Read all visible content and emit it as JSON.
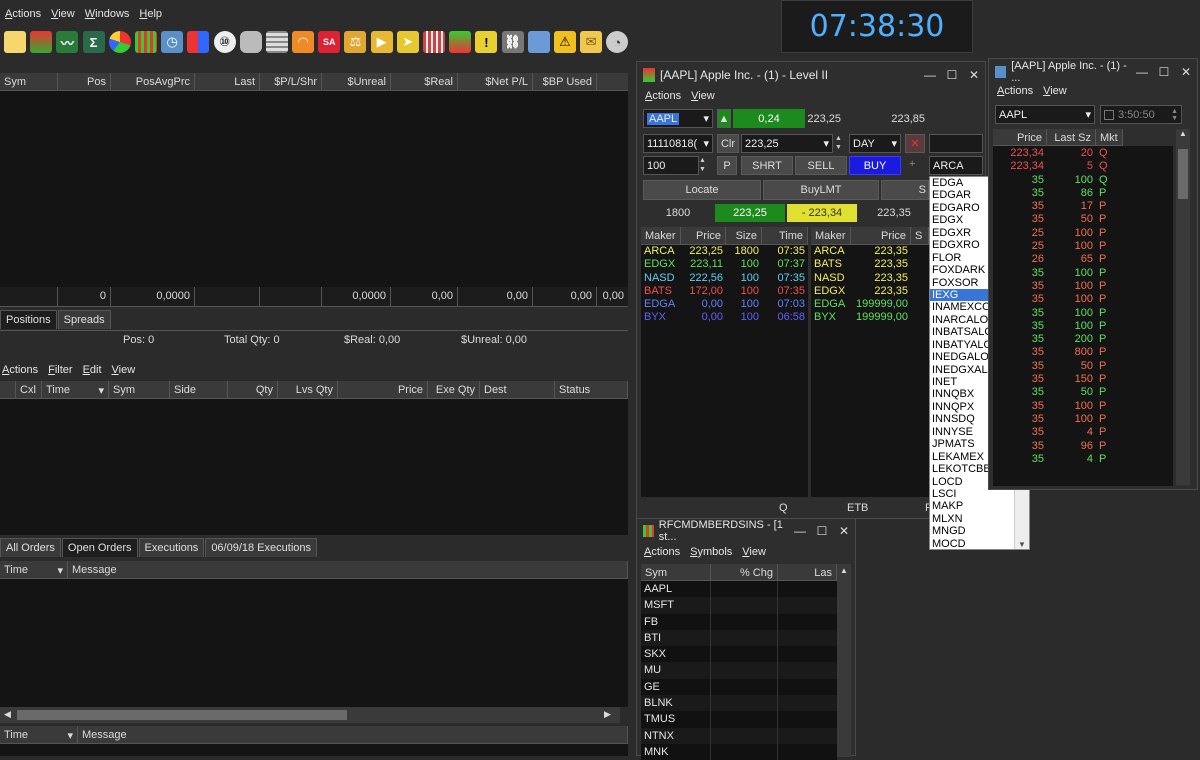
{
  "main": {
    "menu": [
      "Actions",
      "View",
      "Windows",
      "Help"
    ],
    "toolbar_icons": [
      "new-document-icon",
      "book-icon",
      "chart-icon",
      "sigma-icon",
      "pie-icon",
      "bars-icon",
      "calendar-icon",
      "dart-icon",
      "ball-icon",
      "database-icon",
      "grid-icon",
      "rss-icon",
      "sa-icon",
      "scale-icon",
      "speaker-icon",
      "arrow-icon",
      "grid2-icon",
      "doc-icon",
      "warning-icon",
      "link-icon",
      "notebook-icon",
      "alert-icon",
      "mail-icon",
      "gauge-icon"
    ],
    "clock": "07:38:30"
  },
  "positions": {
    "columns": [
      "Sym",
      "Pos",
      "PosAvgPrc",
      "Last",
      "$P/L/Shr",
      "$Unreal",
      "$Real",
      "$Net P/L",
      "$BP Used"
    ],
    "totals": [
      "",
      "0",
      "0,0000",
      "",
      "",
      "0,0000",
      "0,00",
      "0,00",
      "0,00",
      "0,00"
    ],
    "tabs": [
      "Positions",
      "Spreads"
    ],
    "summary": {
      "pos": "Pos: 0",
      "total_qty": "Total Qty: 0",
      "real": "$Real: 0,00",
      "unreal": "$Unreal: 0,00"
    }
  },
  "orders": {
    "menu": [
      "Actions",
      "Filter",
      "Edit",
      "View"
    ],
    "columns": [
      "Cxl",
      "Time",
      "Sym",
      "Side",
      "Qty",
      "Lvs Qty",
      "Price",
      "Exe Qty",
      "Dest",
      "Status"
    ],
    "tabs": [
      "All Orders",
      "Open Orders",
      "Executions",
      "06/09/18 Executions"
    ],
    "msg_columns": [
      "Time",
      "Message"
    ],
    "bottom_columns": [
      "Time",
      "Message"
    ]
  },
  "level2": {
    "title": "[AAPL] Apple Inc. - (1) - Level II",
    "menu": [
      "Actions",
      "View"
    ],
    "symbol": "AAPL",
    "change": "0,24",
    "bid": "223,25",
    "ask": "223,85",
    "account": "11110818(",
    "clr": "Clr",
    "price": "223,25",
    "tif": "DAY",
    "qty": "100",
    "p_label": "P",
    "shrt": "SHRT",
    "sell": "SELL",
    "buy": "BUY",
    "route": "ARCA",
    "locate": "Locate",
    "buylmt": "BuyLMT",
    "s_cut": "S",
    "summary": {
      "size": "1800",
      "bid": "223,25",
      "diff": "- 223,34",
      "ask": "223,35"
    },
    "book_columns": [
      "Maker",
      "Price",
      "Size",
      "Time"
    ],
    "bids": [
      {
        "maker": "ARCA",
        "price": "223,25",
        "size": "1800",
        "time": "07:35",
        "color": "#f0f060"
      },
      {
        "maker": "EDGX",
        "price": "223,11",
        "size": "100",
        "time": "07:37",
        "color": "#60e060"
      },
      {
        "maker": "NASD",
        "price": "222,56",
        "size": "100",
        "time": "07:35",
        "color": "#60d0f0"
      },
      {
        "maker": "BATS",
        "price": "172,00",
        "size": "100",
        "time": "07:35",
        "color": "#f05050"
      },
      {
        "maker": "EDGA",
        "price": "0,00",
        "size": "100",
        "time": "07:03",
        "color": "#6080ff"
      },
      {
        "maker": "BYX",
        "price": "0,00",
        "size": "100",
        "time": "06:58",
        "color": "#6060ff"
      }
    ],
    "ask_columns": [
      "Maker",
      "Price",
      "S"
    ],
    "asks": [
      {
        "maker": "ARCA",
        "price": "223,35",
        "color": "#f0f060"
      },
      {
        "maker": "BATS",
        "price": "223,35",
        "color": "#f0f060"
      },
      {
        "maker": "NASD",
        "price": "223,35",
        "color": "#f0f060"
      },
      {
        "maker": "EDGX",
        "price": "223,35",
        "color": "#f0f060"
      },
      {
        "maker": "EDGA",
        "price": "199999,00",
        "color": "#60e060"
      },
      {
        "maker": "BYX",
        "price": "199999,00",
        "color": "#60e060"
      }
    ],
    "footer": [
      "Q",
      "ETB",
      "F"
    ],
    "dropdown": [
      "EDGA",
      "EDGAR",
      "EDGARO",
      "EDGX",
      "EDGXR",
      "EDGXRO",
      "FLOR",
      "FOXDARK",
      "FOXSOR",
      "IEXG",
      "INAMEXCO",
      "INARCALO",
      "INBATSALO",
      "INBATYALO",
      "INEDGALO",
      "INEDGXALO",
      "INET",
      "INNQBX",
      "INNQPX",
      "INNSDQ",
      "INNYSE",
      "JPMATS",
      "LEKAMEX",
      "LEKOTCBB",
      "LOCD",
      "LSCI",
      "MAKP",
      "MLXN",
      "MNGD",
      "MOCD"
    ],
    "dropdown_selected": 9
  },
  "timesales": {
    "title": "[AAPL] Apple Inc. - (1) - ...",
    "menu": [
      "Actions",
      "View"
    ],
    "symbol": "AAPL",
    "time": "3:50:50",
    "columns": [
      "Price",
      "Last Sz",
      "Mkt"
    ],
    "rows": [
      {
        "price": "223,34",
        "size": "20",
        "mkt": "Q",
        "color": "#f05050"
      },
      {
        "price": "223,34",
        "size": "5",
        "mkt": "Q",
        "color": "#f05050"
      },
      {
        "price": "35",
        "size": "100",
        "mkt": "Q",
        "color": "#60e060"
      },
      {
        "price": "35",
        "size": "86",
        "mkt": "P",
        "color": "#60e060"
      },
      {
        "price": "35",
        "size": "17",
        "mkt": "P",
        "color": "#f07050"
      },
      {
        "price": "35",
        "size": "50",
        "mkt": "P",
        "color": "#f07050"
      },
      {
        "price": "25",
        "size": "100",
        "mkt": "P",
        "color": "#f07050"
      },
      {
        "price": "25",
        "size": "100",
        "mkt": "P",
        "color": "#f07050"
      },
      {
        "price": "26",
        "size": "65",
        "mkt": "P",
        "color": "#f07050"
      },
      {
        "price": "35",
        "size": "100",
        "mkt": "P",
        "color": "#60e060"
      },
      {
        "price": "35",
        "size": "100",
        "mkt": "P",
        "color": "#f07050"
      },
      {
        "price": "35",
        "size": "100",
        "mkt": "P",
        "color": "#f07050"
      },
      {
        "price": "35",
        "size": "100",
        "mkt": "P",
        "color": "#60e060"
      },
      {
        "price": "35",
        "size": "100",
        "mkt": "P",
        "color": "#60e060"
      },
      {
        "price": "35",
        "size": "200",
        "mkt": "P",
        "color": "#60e060"
      },
      {
        "price": "35",
        "size": "800",
        "mkt": "P",
        "color": "#f07050"
      },
      {
        "price": "35",
        "size": "50",
        "mkt": "P",
        "color": "#f07050"
      },
      {
        "price": "35",
        "size": "150",
        "mkt": "P",
        "color": "#f07050"
      },
      {
        "price": "35",
        "size": "50",
        "mkt": "P",
        "color": "#60e060"
      },
      {
        "price": "35",
        "size": "100",
        "mkt": "P",
        "color": "#f07050"
      },
      {
        "price": "35",
        "size": "100",
        "mkt": "P",
        "color": "#f07050"
      },
      {
        "price": "35",
        "size": "4",
        "mkt": "P",
        "color": "#f07050"
      },
      {
        "price": "35",
        "size": "96",
        "mkt": "P",
        "color": "#f07050"
      },
      {
        "price": "35",
        "size": "4",
        "mkt": "P",
        "color": "#60e060"
      }
    ]
  },
  "watchlist": {
    "title": "RFCMDMBERDSINS - [1 st...",
    "menu": [
      "Actions",
      "Symbols",
      "View"
    ],
    "columns": [
      "Sym",
      "% Chg",
      "Las"
    ],
    "rows": [
      "AAPL",
      "MSFT",
      "FB",
      "BTI",
      "SKX",
      "MU",
      "GE",
      "BLNK",
      "TMUS",
      "NTNX",
      "MNK"
    ]
  }
}
